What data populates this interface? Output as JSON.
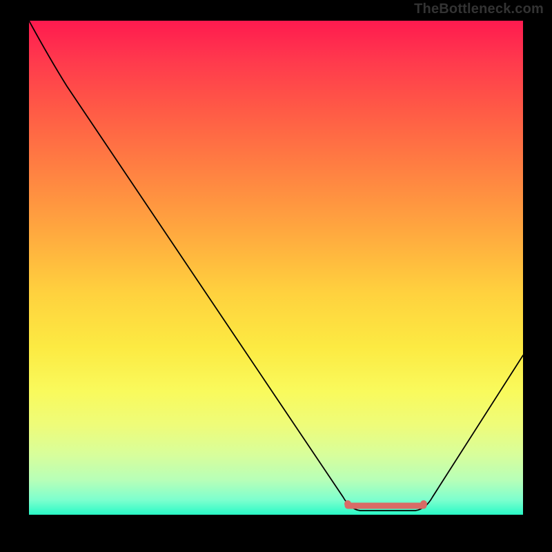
{
  "watermark": "TheBottleneck.com",
  "chart_data": {
    "type": "line",
    "title": "",
    "xlabel": "",
    "ylabel": "",
    "x": [
      0.0,
      0.04,
      0.08,
      0.64,
      0.67,
      0.78,
      0.82,
      1.0
    ],
    "values": [
      100,
      92,
      87,
      0,
      0,
      0,
      3,
      32
    ],
    "ylim": [
      0,
      100
    ],
    "xlim": [
      0,
      1
    ],
    "background": "vertical-gradient red→yellow→green",
    "highlight_range_x": [
      0.65,
      0.8
    ],
    "highlight_color": "#d96b66",
    "series": [
      {
        "name": "bottleneck-curve",
        "x": [
          0.0,
          0.04,
          0.08,
          0.64,
          0.67,
          0.78,
          0.82,
          1.0
        ],
        "values": [
          100,
          92,
          87,
          0,
          0,
          0,
          3,
          32
        ],
        "color": "#000000"
      }
    ],
    "annotations": [
      {
        "text": "TheBottleneck.com",
        "position": "top-right"
      }
    ]
  },
  "colors": {
    "gradient_top": "#ff1a4f",
    "gradient_mid": "#fcea42",
    "gradient_bottom": "#29f9c6",
    "curve": "#000000",
    "highlight": "#d96b66",
    "frame": "#000000"
  }
}
